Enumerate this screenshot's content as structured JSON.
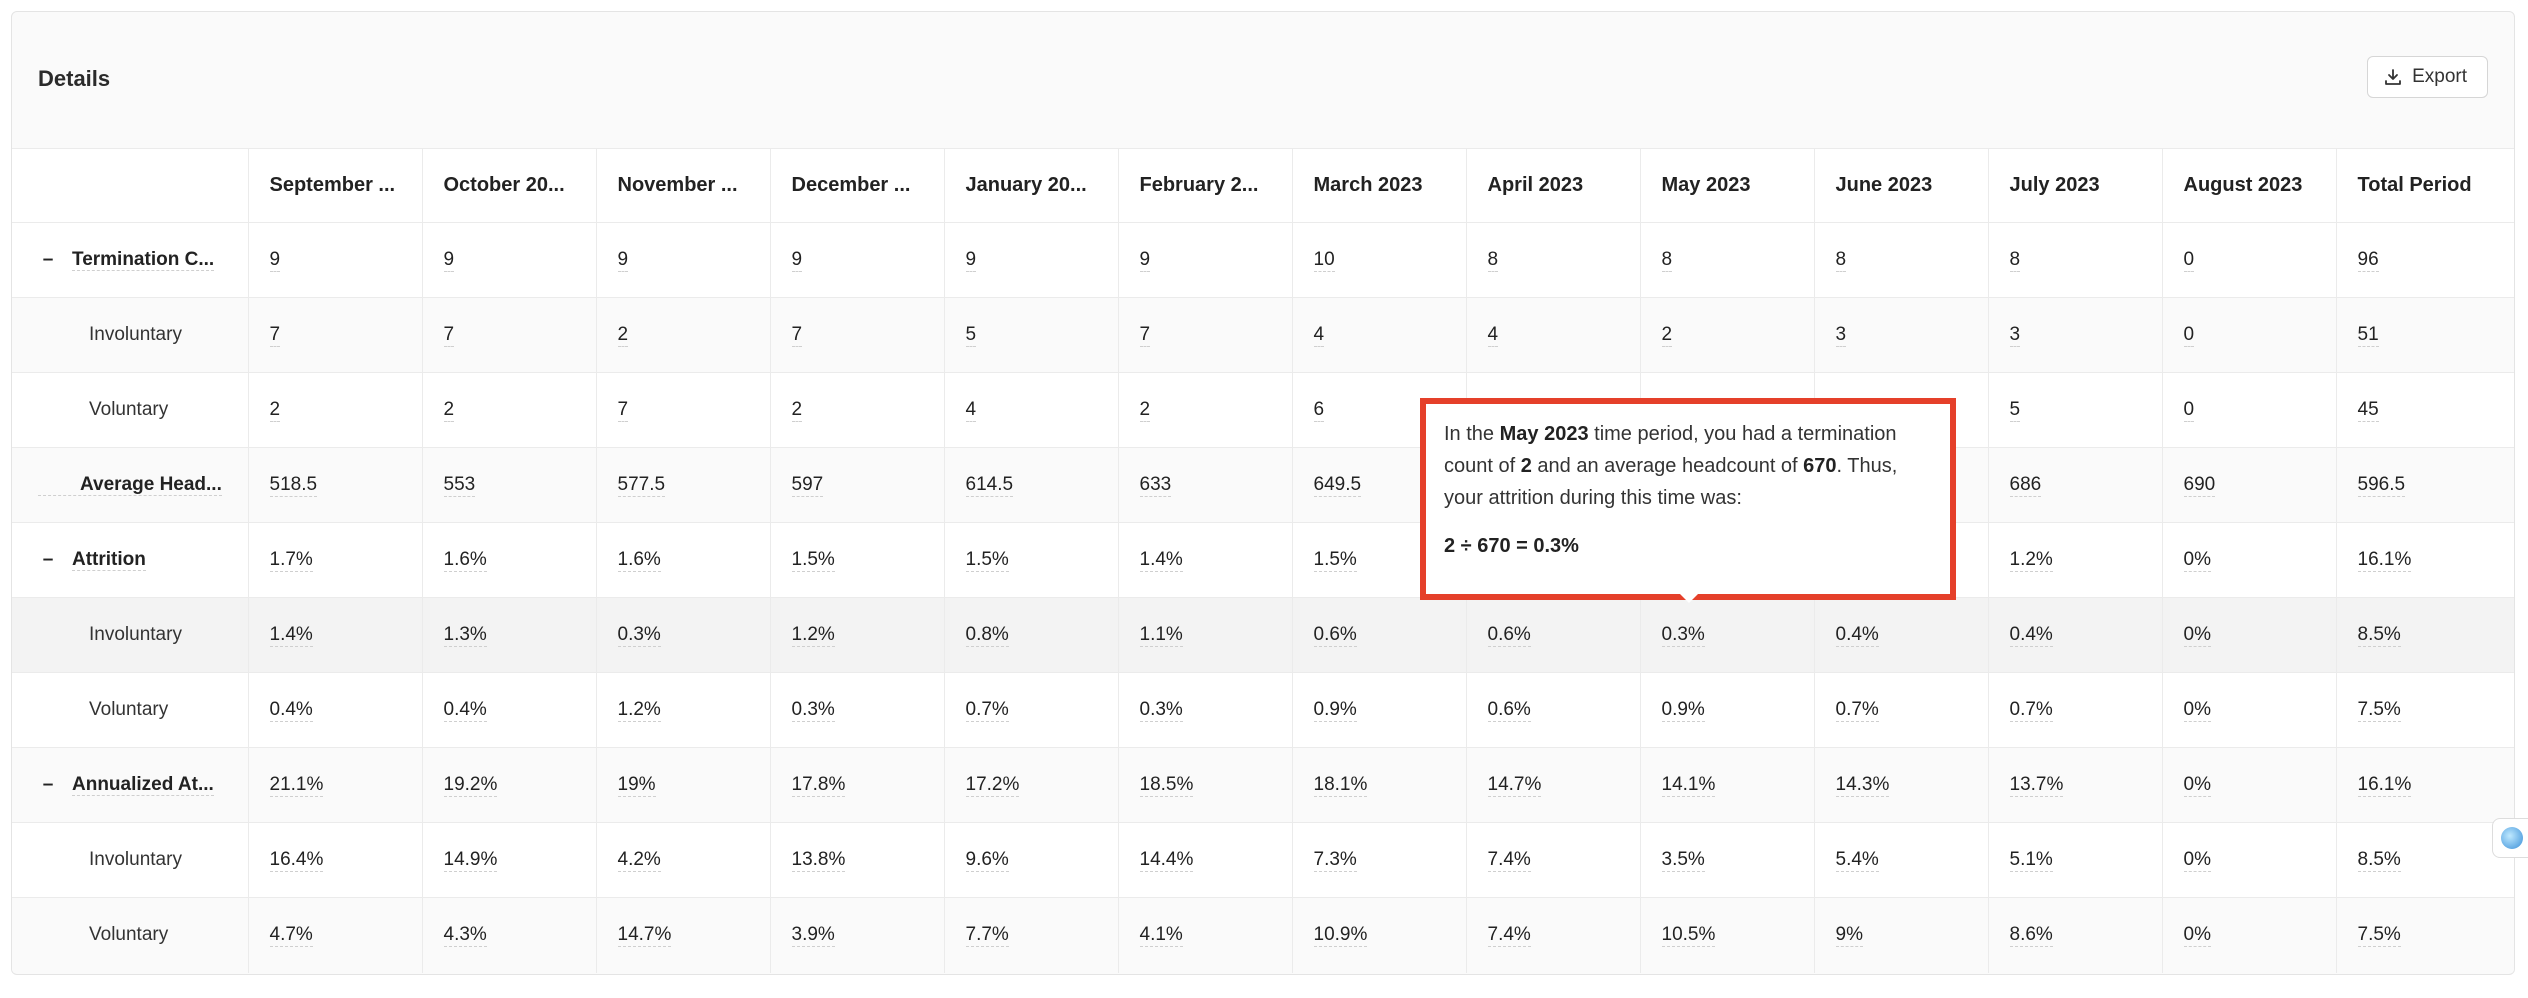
{
  "header": {
    "title": "Details",
    "export_label": "Export"
  },
  "columns": [
    "",
    "September ...",
    "October 20...",
    "November ...",
    "December ...",
    "January 20...",
    "February 2...",
    "March 2023",
    "April 2023",
    "May 2023",
    "June 2023",
    "July 2023",
    "August 2023",
    "Total Period"
  ],
  "rows": [
    {
      "label": "Termination C...",
      "level": "parent",
      "toggle": "–",
      "values": [
        "9",
        "9",
        "9",
        "9",
        "9",
        "9",
        "10",
        "8",
        "8",
        "8",
        "8",
        "0",
        "96"
      ]
    },
    {
      "label": "Involuntary",
      "level": "child",
      "values": [
        "7",
        "7",
        "2",
        "7",
        "5",
        "7",
        "4",
        "4",
        "2",
        "3",
        "3",
        "0",
        "51"
      ]
    },
    {
      "label": "Voluntary",
      "level": "child",
      "values": [
        "2",
        "2",
        "7",
        "2",
        "4",
        "2",
        "6",
        "",
        "",
        "",
        "5",
        "0",
        "45"
      ]
    },
    {
      "label": "Average Head...",
      "level": "plain",
      "values": [
        "518.5",
        "553",
        "577.5",
        "597",
        "614.5",
        "633",
        "649.5",
        "",
        "",
        "",
        "686",
        "690",
        "596.5"
      ]
    },
    {
      "label": "Attrition",
      "level": "parent",
      "toggle": "–",
      "values": [
        "1.7%",
        "1.6%",
        "1.6%",
        "1.5%",
        "1.5%",
        "1.4%",
        "1.5%",
        "",
        "",
        "",
        "1.2%",
        "0%",
        "16.1%"
      ]
    },
    {
      "label": "Involuntary",
      "level": "child",
      "highlight": true,
      "values": [
        "1.4%",
        "1.3%",
        "0.3%",
        "1.2%",
        "0.8%",
        "1.1%",
        "0.6%",
        "0.6%",
        "0.3%",
        "0.4%",
        "0.4%",
        "0%",
        "8.5%"
      ]
    },
    {
      "label": "Voluntary",
      "level": "child",
      "values": [
        "0.4%",
        "0.4%",
        "1.2%",
        "0.3%",
        "0.7%",
        "0.3%",
        "0.9%",
        "0.6%",
        "0.9%",
        "0.7%",
        "0.7%",
        "0%",
        "7.5%"
      ]
    },
    {
      "label": "Annualized At...",
      "level": "parent",
      "toggle": "–",
      "values": [
        "21.1%",
        "19.2%",
        "19%",
        "17.8%",
        "17.2%",
        "18.5%",
        "18.1%",
        "14.7%",
        "14.1%",
        "14.3%",
        "13.7%",
        "0%",
        "16.1%"
      ]
    },
    {
      "label": "Involuntary",
      "level": "child",
      "values": [
        "16.4%",
        "14.9%",
        "4.2%",
        "13.8%",
        "9.6%",
        "14.4%",
        "7.3%",
        "7.4%",
        "3.5%",
        "5.4%",
        "5.1%",
        "0%",
        "8.5%"
      ]
    },
    {
      "label": "Voluntary",
      "level": "child",
      "values": [
        "4.7%",
        "4.3%",
        "14.7%",
        "3.9%",
        "7.7%",
        "4.1%",
        "10.9%",
        "7.4%",
        "10.5%",
        "9%",
        "8.6%",
        "0%",
        "7.5%"
      ]
    }
  ],
  "tooltip": {
    "t1": "In the ",
    "period": "May 2023",
    "t2": " time period, you had a termination count of ",
    "termination_count": "2",
    "t3": " and an average headcount of ",
    "headcount": "670",
    "t4": ". Thus, your attrition during this time was:",
    "formula": "2 ÷ 670 = 0.3%"
  },
  "colors": {
    "tooltip_border": "#e5402a"
  },
  "icons": {
    "export": "download-icon",
    "side_widget": "assistant-bubble-icon"
  }
}
